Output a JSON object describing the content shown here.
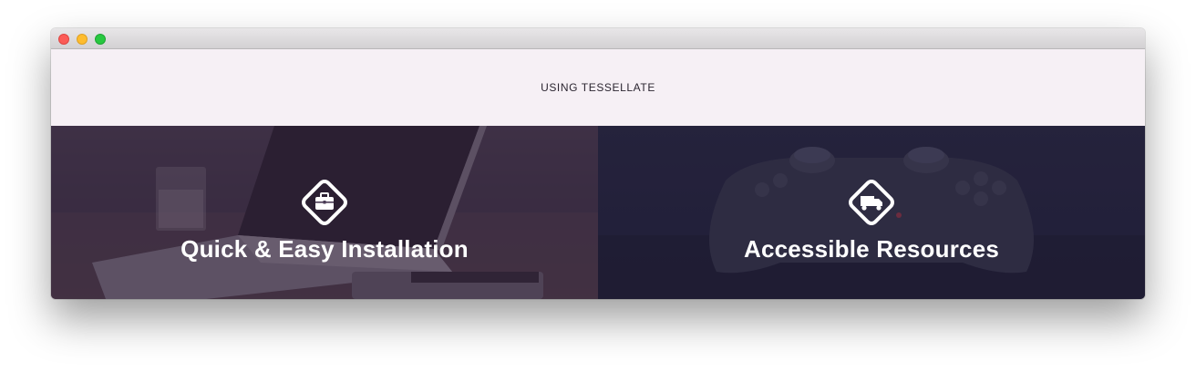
{
  "window": {
    "controls": [
      "close",
      "minimize",
      "zoom"
    ]
  },
  "section": {
    "title": "USING TESSELLATE"
  },
  "features": [
    {
      "title": "Quick & Easy Installation",
      "icon": "briefcase-icon"
    },
    {
      "title": "Accessible Resources",
      "icon": "truck-icon"
    }
  ],
  "colors": {
    "band_background": "#f6f0f5",
    "feature_text": "#ffffff",
    "close": "#fc5b57",
    "minimize": "#febc2e",
    "zoom": "#28c840"
  }
}
